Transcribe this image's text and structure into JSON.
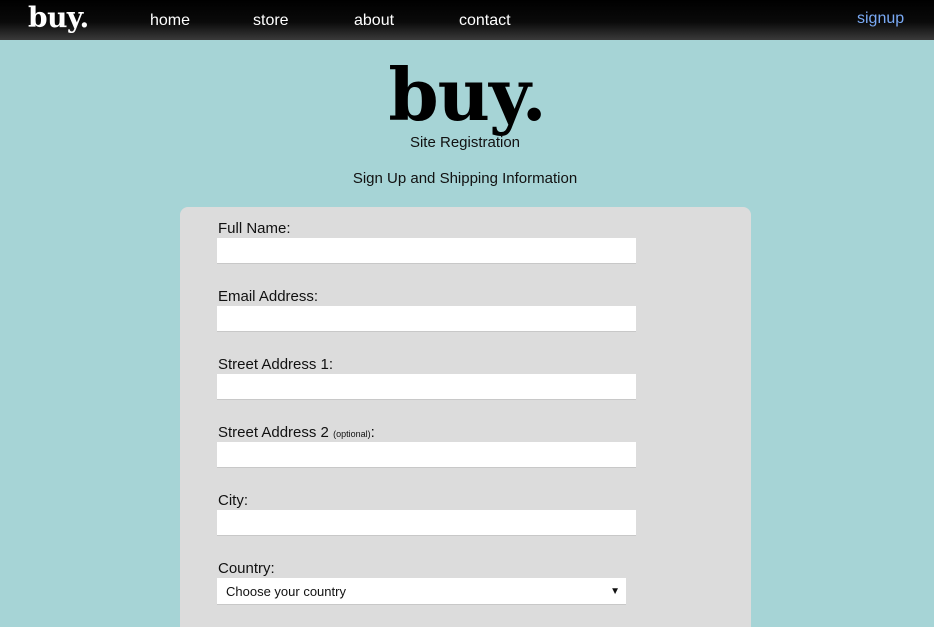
{
  "nav": {
    "logo": "buy.",
    "items": [
      {
        "label": "home"
      },
      {
        "label": "store"
      },
      {
        "label": "about"
      },
      {
        "label": "contact"
      }
    ],
    "signup_label": "signup",
    "signup_color": "#7aaaf5"
  },
  "hero": {
    "logo": "buy.",
    "subtitle": "Site Registration",
    "section_title": "Sign Up and Shipping Information"
  },
  "form": {
    "fields": [
      {
        "label": "Full Name:",
        "value": ""
      },
      {
        "label": "Email Address:",
        "value": ""
      },
      {
        "label": "Street Address 1:",
        "value": ""
      },
      {
        "label": "Street Address 2",
        "optional_note": "(optional)",
        "suffix": ":",
        "value": ""
      },
      {
        "label": "City:",
        "value": ""
      }
    ],
    "country": {
      "label": "Country:",
      "selected": "Choose your country",
      "arrow_icon": "triangle-down-icon"
    }
  },
  "colors": {
    "background": "#a6d4d6",
    "card": "#dcdcdc",
    "navbar": "#000000"
  }
}
